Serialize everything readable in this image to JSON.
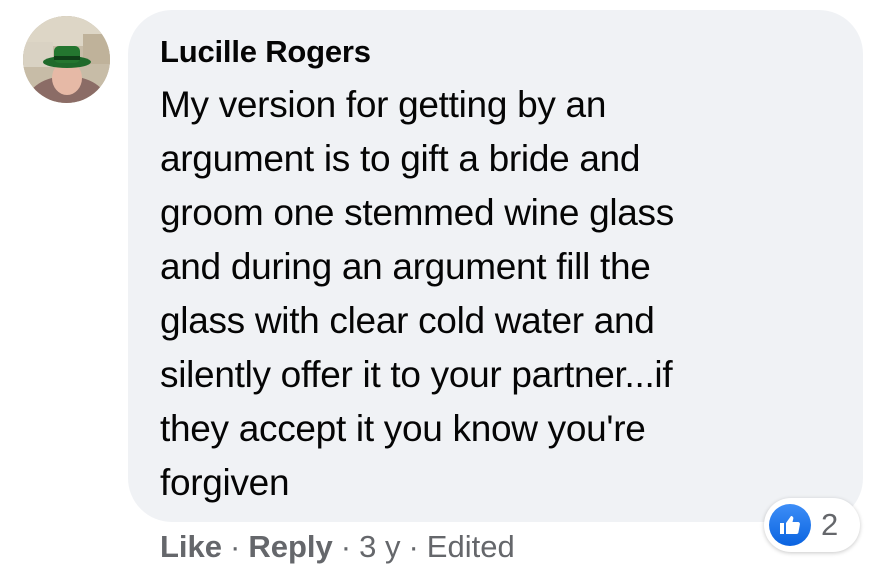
{
  "comment": {
    "author": "Lucille Rogers",
    "body_lines": [
      "My version for getting by an",
      "argument is to gift a bride and",
      "groom one stemmed wine glass",
      "and during an argument fill the",
      "glass with clear cold water and",
      "silently offer it to your partner...if",
      "they accept it you know you're",
      "forgiven"
    ],
    "actions": {
      "like_label": "Like",
      "reply_label": "Reply",
      "separator": "·",
      "time": "3 y",
      "edited_label": "Edited"
    },
    "reactions": {
      "icon": "thumbs-up-icon",
      "count": "2",
      "color": "#1877f2"
    }
  },
  "colors": {
    "bubble_bg": "#f0f2f5",
    "text": "#050505",
    "secondary_text": "#65676b",
    "like_blue": "#1877f2"
  }
}
